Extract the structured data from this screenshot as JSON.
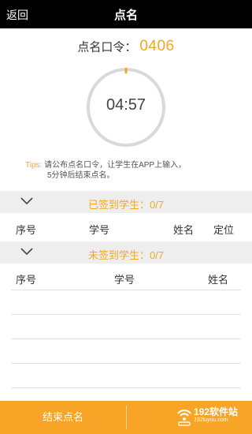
{
  "header": {
    "back_label": "返回",
    "title": "点名"
  },
  "code": {
    "label": "点名口令：",
    "value": "0406"
  },
  "timer": {
    "value": "04:57"
  },
  "tips": {
    "label": "Tips:",
    "line1": "请公布点名口令，让学生在APP上输入，",
    "line2": "5分钟后结束点名。"
  },
  "signed": {
    "title": "已签到学生：0/7",
    "columns": [
      "序号",
      "学号",
      "姓名",
      "定位"
    ]
  },
  "unsigned": {
    "title": "未签到学生：0/7",
    "columns": [
      "序号",
      "学号",
      "姓名"
    ]
  },
  "footer": {
    "end_label": "结束点名"
  },
  "watermark": {
    "text": "192软件站",
    "sub": "192luyou.com"
  },
  "colors": {
    "accent": "#f5a623",
    "topbar": "#000000",
    "footer": "#f7a427",
    "section_bg": "#eeeeee"
  }
}
